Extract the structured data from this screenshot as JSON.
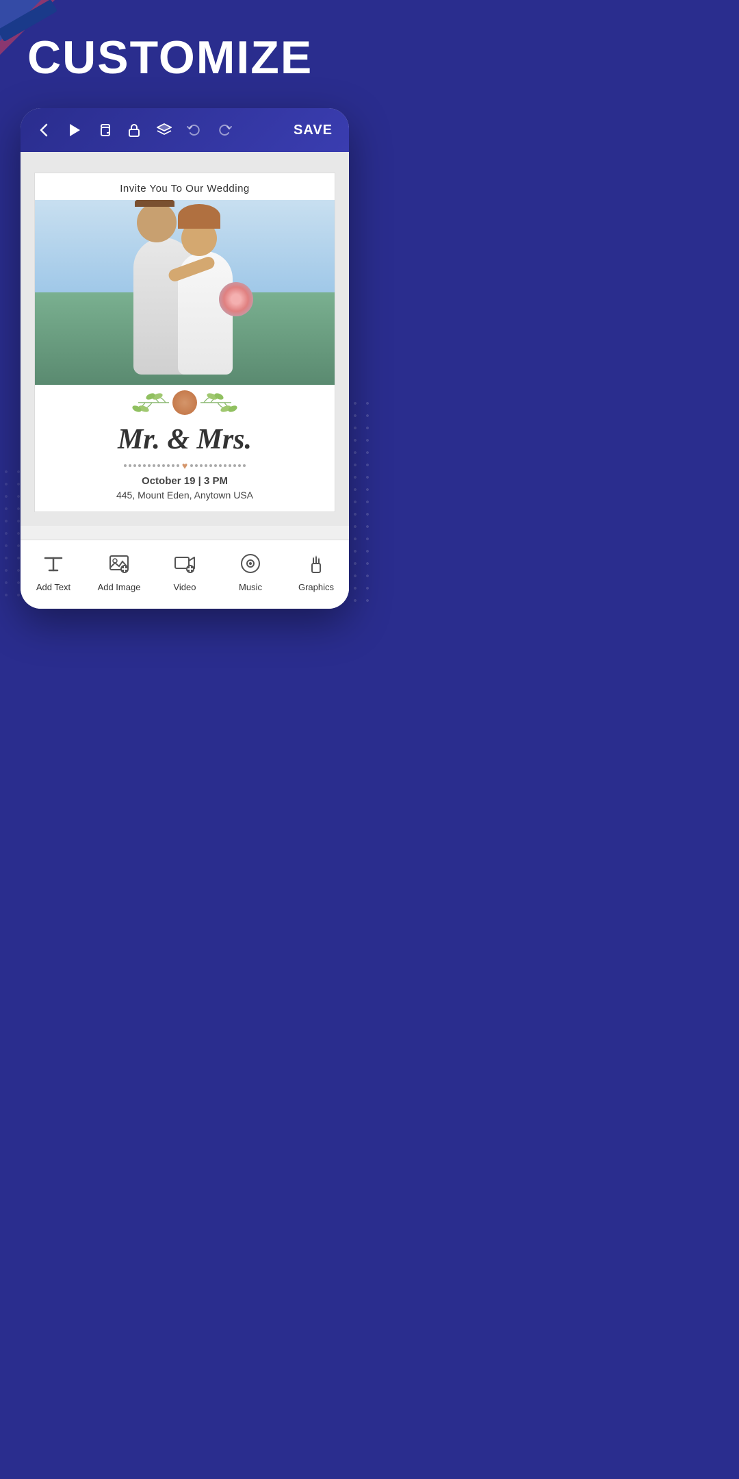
{
  "page": {
    "title": "CUSTOMIZE",
    "background_color": "#2a2d8e"
  },
  "toolbar": {
    "back_label": "‹",
    "play_label": "▶",
    "copy_label": "⧉",
    "lock_label": "🔒",
    "layers_label": "⊞",
    "undo_label": "↩",
    "redo_label": "↪",
    "save_label": "SAVE"
  },
  "card": {
    "header_text": "Invite You To Our Wedding",
    "names": "Mr. & Mrs.",
    "date": "October 19 | 3 PM",
    "address": "445, Mount Eden, Anytown USA"
  },
  "bottom_nav": {
    "items": [
      {
        "id": "add-text",
        "label": "Add Text",
        "icon": "text"
      },
      {
        "id": "add-image",
        "label": "Add Image",
        "icon": "image"
      },
      {
        "id": "video",
        "label": "Video",
        "icon": "video"
      },
      {
        "id": "music",
        "label": "Music",
        "icon": "music"
      },
      {
        "id": "graphics",
        "label": "Graphics",
        "icon": "graphics"
      }
    ]
  }
}
